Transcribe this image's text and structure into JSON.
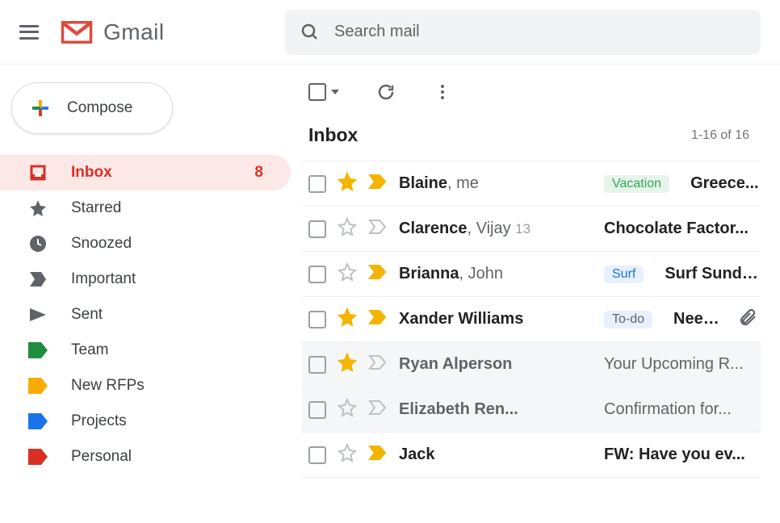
{
  "header": {
    "app_name": "Gmail",
    "search_placeholder": "Search mail"
  },
  "sidebar": {
    "compose_label": "Compose",
    "items": [
      {
        "label": "Inbox",
        "badge": "8",
        "color": "#d93025"
      },
      {
        "label": "Starred",
        "color": "#5f6368"
      },
      {
        "label": "Snoozed",
        "color": "#5f6368"
      },
      {
        "label": "Important",
        "color": "#5f6368"
      },
      {
        "label": "Sent",
        "color": "#5f6368"
      },
      {
        "label": "Team",
        "color": "#1e8e3e"
      },
      {
        "label": "New RFPs",
        "color": "#f9ab00"
      },
      {
        "label": "Projects",
        "color": "#1a73e8"
      },
      {
        "label": "Personal",
        "color": "#d93025"
      }
    ]
  },
  "main": {
    "section_title": "Inbox",
    "count_text": "1-16 of 16",
    "labels": {
      "vacation": {
        "text": "Vacation",
        "bg": "#e6f4ea",
        "fg": "#34a853"
      },
      "surf": {
        "text": "Surf",
        "bg": "#e8f0fe",
        "fg": "#1a73e8"
      },
      "todo": {
        "text": "To-do",
        "bg": "#e8f0fe",
        "fg": "#5f6368"
      }
    },
    "rows": [
      {
        "sender_bold": "Blaine",
        "sender_rest": ", me",
        "subject": "Greece...",
        "label": "vacation",
        "starred": true,
        "important": true,
        "unread": true,
        "attach": false
      },
      {
        "sender_bold": "Clarence",
        "sender_rest": ", Vijay ",
        "thread_count": "13",
        "subject": "Chocolate Factor...",
        "starred": false,
        "important": false,
        "unread": true,
        "attach": false
      },
      {
        "sender_bold": "Brianna",
        "sender_rest": ", John",
        "subject": "Surf Sunda...",
        "label": "surf",
        "starred": false,
        "important": true,
        "unread": true,
        "attach": false
      },
      {
        "sender_bold": "Xander Williams",
        "sender_rest": "",
        "subject": "Need...",
        "label": "todo",
        "starred": true,
        "important": true,
        "unread": true,
        "attach": true
      },
      {
        "sender_bold": "Ryan Alperson",
        "sender_rest": "",
        "subject": "Your Upcoming R...",
        "starred": true,
        "important": false,
        "unread": false,
        "attach": false
      },
      {
        "sender_bold": "Elizabeth Ren...",
        "sender_rest": "",
        "subject": "Confirmation for...",
        "starred": false,
        "important": false,
        "unread": false,
        "attach": false
      },
      {
        "sender_bold": "Jack",
        "sender_rest": "",
        "subject": "FW: Have you ev...",
        "starred": false,
        "important": true,
        "unread": true,
        "attach": false
      }
    ]
  }
}
